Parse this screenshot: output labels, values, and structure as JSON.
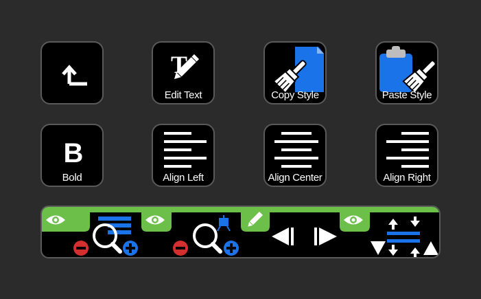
{
  "keys": [
    {
      "id": "back",
      "label": "",
      "icon": "corner-up-arrow-icon"
    },
    {
      "id": "edit-text",
      "label": "Edit Text",
      "icon": "text-edit-pencil-icon"
    },
    {
      "id": "copy-style",
      "label": "Copy Style",
      "icon": "paintbrush-document-icon"
    },
    {
      "id": "paste-style",
      "label": "Paste Style",
      "icon": "paintbrush-clipboard-icon"
    },
    {
      "id": "bold",
      "label": "Bold",
      "glyph": "B",
      "icon": "bold-icon"
    },
    {
      "id": "align-left",
      "label": "Align Left",
      "icon": "align-left-icon"
    },
    {
      "id": "align-center",
      "label": "Align Center",
      "icon": "align-center-icon"
    },
    {
      "id": "align-right",
      "label": "Align Right",
      "icon": "align-right-icon"
    }
  ],
  "colors": {
    "background": "#2b2b2b",
    "key_background": "#000000",
    "key_border": "#5a5a5a",
    "accent_green": "#6cc04a",
    "accent_blue": "#1a73e8",
    "accent_red": "#d32f2f",
    "glyph": "#ffffff"
  },
  "strip": {
    "segments": [
      {
        "id": "zoom-text",
        "icons": [
          "eye-icon",
          "zoom-out-icon",
          "magnifier-icon",
          "zoom-in-icon",
          "text-lines-icon"
        ]
      },
      {
        "id": "zoom-object",
        "icons": [
          "eye-icon",
          "zoom-out-icon",
          "magnifier-icon",
          "zoom-in-icon",
          "easel-icon"
        ]
      },
      {
        "id": "navigate",
        "icons": [
          "pencil-icon",
          "previous-icon",
          "next-icon"
        ]
      },
      {
        "id": "spacing",
        "icons": [
          "eye-icon",
          "spacing-icon",
          "decrease-triangle-icon",
          "increase-triangle-icon"
        ]
      }
    ]
  }
}
